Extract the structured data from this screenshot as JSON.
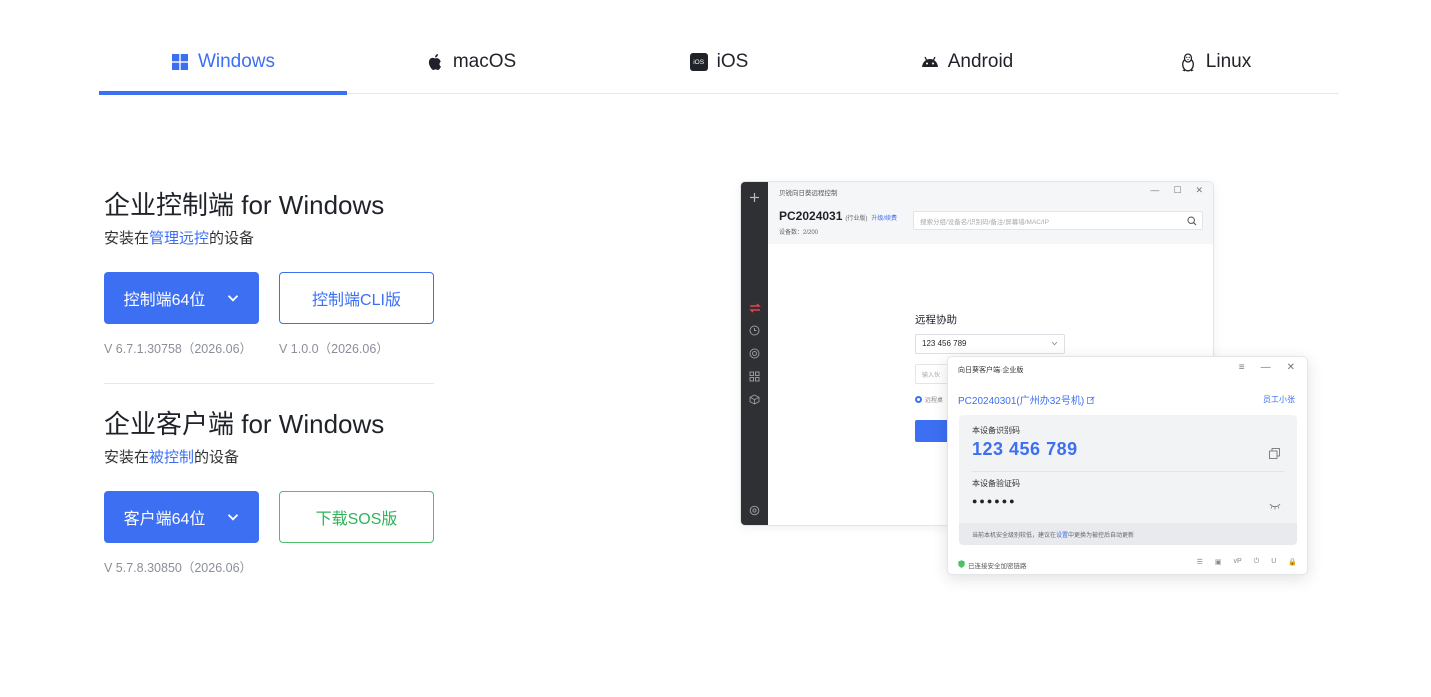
{
  "tabs": [
    {
      "label": "Windows",
      "icon": "windows-icon",
      "active": true
    },
    {
      "label": "macOS",
      "icon": "apple-icon",
      "active": false
    },
    {
      "label": "iOS",
      "icon": "ios-icon",
      "active": false
    },
    {
      "label": "Android",
      "icon": "android-icon",
      "active": false
    },
    {
      "label": "Linux",
      "icon": "linux-icon",
      "active": false
    }
  ],
  "ios_badge": "iOS",
  "controller": {
    "title": "企业控制端 for Windows",
    "sub_prefix": "安装在",
    "sub_highlight": "管理远控",
    "sub_suffix": "的设备",
    "primary_label": "控制端64位",
    "secondary_label": "控制端CLI版",
    "primary_version": "V 6.7.1.30758（2026.06）",
    "secondary_version": "V 1.0.0（2026.06）"
  },
  "client": {
    "title": "企业客户端 for Windows",
    "sub_prefix": "安装在",
    "sub_highlight": "被控制",
    "sub_suffix": "的设备",
    "primary_label": "客户端64位",
    "secondary_label": "下载SOS版",
    "primary_version": "V 5.7.8.30850（2026.06）"
  },
  "mock_controller": {
    "app_name": "贝锐向日葵远程控制",
    "window_controls": [
      "—",
      "☐",
      "✕"
    ],
    "pc_name": "PC2024031",
    "edition": "(行业版)",
    "upgrade": "升级/续费",
    "device_count": "设备数：2/200",
    "search_placeholder": "搜索分组/设备名/识别码/备注/屏幕墙/MAC/IP",
    "remote_title": "远程协助",
    "remote_code": "123 456 789",
    "remote_input_placeholder": "输入伙",
    "remote_radio_label": "远程桌"
  },
  "mock_client": {
    "title": "向日葵客户端·企业版",
    "window_controls": [
      "≡",
      "—",
      "✕"
    ],
    "pc_name": "PC20240301(广州办32号机)",
    "user": "员工小张",
    "id_label": "本设备识别码",
    "id_code": "123 456 789",
    "verify_label": "本设备验证码",
    "verify_code": "●●●●●●",
    "note_prefix": "当前本机安全级别较低，建议在",
    "note_link": "设置",
    "note_suffix": "中更换为被控后自动更新",
    "footer": "已连接安全加密链路",
    "footer_icons": [
      "☰",
      "▣",
      "vP",
      "⏻",
      "U",
      "🔒"
    ]
  },
  "colors": {
    "accent": "#3d6ff2",
    "green": "#2fb45a",
    "sidebar": "#2f3033",
    "side_accent": "#e8424c"
  }
}
